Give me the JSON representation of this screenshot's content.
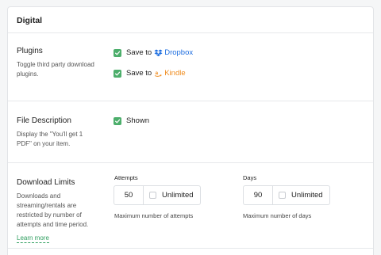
{
  "header": {
    "title": "Digital"
  },
  "plugins": {
    "title": "Plugins",
    "description": "Toggle third party download plugins.",
    "options": [
      {
        "prefix": "Save to",
        "brand": "Dropbox",
        "icon": "dropbox-icon",
        "checked": true
      },
      {
        "prefix": "Save to",
        "brand": "Kindle",
        "icon": "amazon-icon",
        "checked": true
      }
    ]
  },
  "file_description": {
    "title": "File Description",
    "description": "Display the \"You'll get 1 PDF\" on your item.",
    "option": {
      "label": "Shown",
      "checked": true
    }
  },
  "download_limits": {
    "title": "Download Limits",
    "description": "Downloads and streaming/rentals are restricted by number of attempts and time period.",
    "learn_more": "Learn more",
    "attempts": {
      "label": "Attempts",
      "value": "50",
      "unlimited_label": "Unlimited",
      "unlimited_checked": false,
      "help": "Maximum number of attempts"
    },
    "days": {
      "label": "Days",
      "value": "90",
      "unlimited_label": "Unlimited",
      "unlimited_checked": false,
      "help": "Maximum number of days"
    }
  },
  "colors": {
    "accent_green": "#4cae6b",
    "dropbox_blue": "#1f6fe0",
    "kindle_orange": "#ef8b1d"
  }
}
